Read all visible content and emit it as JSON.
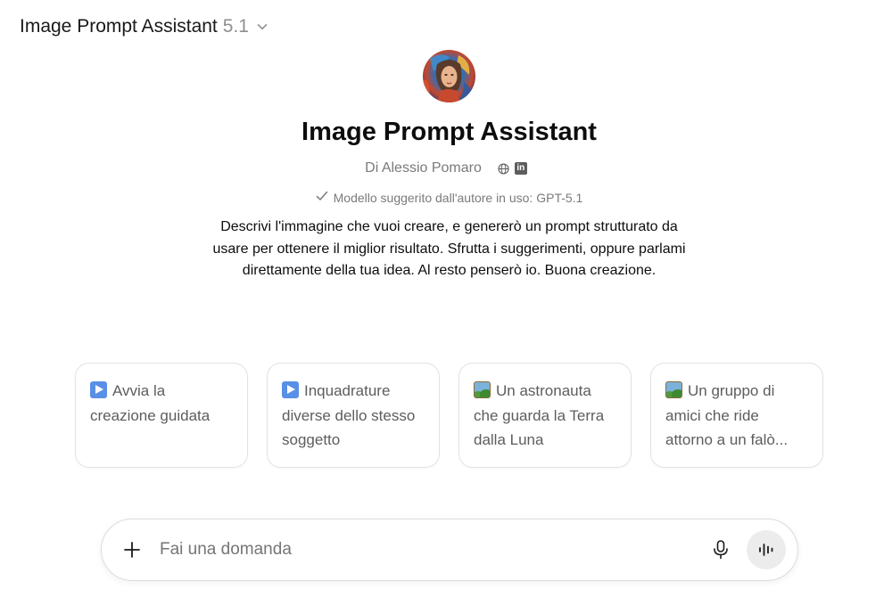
{
  "header": {
    "model_name": "Image Prompt Assistant",
    "model_version": "5.1",
    "chevron_icon": "chevron-down-icon"
  },
  "gpt": {
    "title": "Image Prompt Assistant",
    "author": "Di Alessio Pomaro",
    "author_icons": [
      "globe-icon",
      "linkedin-icon"
    ],
    "suggested_model": "Modello suggerito dall'autore in uso: GPT-5.1",
    "description": "Descrivi l'immagine che vuoi creare, e genererò un prompt strutturato da usare per ottenere il miglior risultato. Sfrutta i suggerimenti, oppure parlami direttamente della tua idea. Al resto penserò io. Buona creazione."
  },
  "starters": [
    {
      "icon": "play-button-emoji",
      "text": "Avvia la creazione guidata"
    },
    {
      "icon": "play-button-emoji",
      "text": "Inquadrature diverse dello stesso soggetto"
    },
    {
      "icon": "framed-picture-emoji",
      "text": "Un astronauta che guarda la Terra dalla Luna"
    },
    {
      "icon": "framed-picture-emoji",
      "text": "Un gruppo di amici che ride attorno a un falò..."
    }
  ],
  "composer": {
    "placeholder": "Fai una domanda",
    "icons": [
      "plus-icon",
      "microphone-icon",
      "voice-mode-icon"
    ]
  },
  "colors": {
    "text_primary": "#0d0d0d",
    "text_secondary": "#7a7a7a",
    "border": "#e3e3e3",
    "voice_button_bg": "#ececec"
  }
}
